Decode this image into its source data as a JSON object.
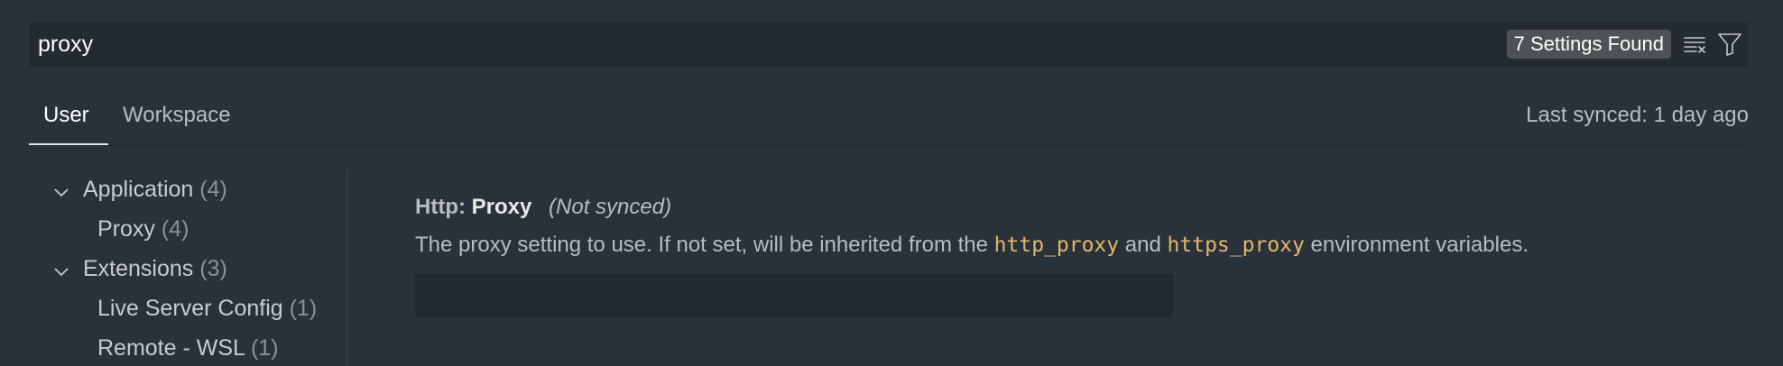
{
  "search": {
    "value": "proxy",
    "results_badge": "7 Settings Found"
  },
  "tabs": [
    {
      "label": "User",
      "active": true
    },
    {
      "label": "Workspace",
      "active": false
    }
  ],
  "last_synced": "Last synced: 1 day ago",
  "toc": {
    "items": [
      {
        "label": "Application",
        "count": "(4)",
        "expanded": true,
        "level": 0
      },
      {
        "label": "Proxy",
        "count": "(4)",
        "level": 1
      },
      {
        "label": "Extensions",
        "count": "(3)",
        "expanded": true,
        "level": 0
      },
      {
        "label": "Live Server Config",
        "count": "(1)",
        "level": 1
      },
      {
        "label": "Remote - WSL",
        "count": "(1)",
        "level": 1
      }
    ]
  },
  "setting": {
    "category": "Http: ",
    "name": "Proxy",
    "not_synced": "(Not synced)",
    "desc_part1": "The proxy setting to use. If not set, will be inherited from the ",
    "code1": "http_proxy",
    "desc_part2": " and ",
    "code2": "https_proxy",
    "desc_part3": " environment variables.",
    "value": ""
  },
  "colors": {
    "background": "#29323a",
    "input_background": "#232a30",
    "badge_background": "#4e5254",
    "code_accent": "#e0b86a"
  },
  "icons": [
    "clear-filter-icon",
    "filter-icon",
    "chevron-down-icon"
  ]
}
